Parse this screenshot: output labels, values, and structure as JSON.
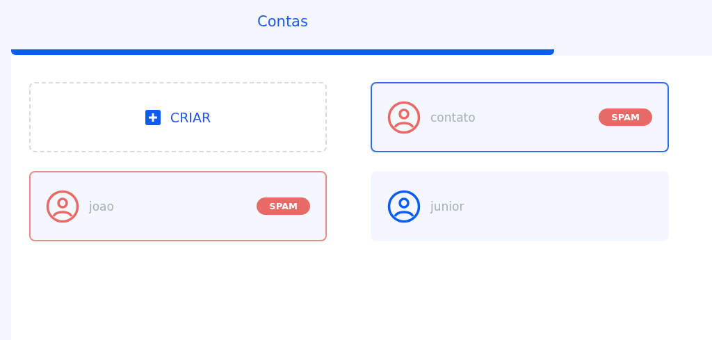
{
  "tabs": [
    {
      "label": "Contas",
      "selected": true
    }
  ],
  "create_button": {
    "label": "CRIAR"
  },
  "accounts": [
    {
      "name": "contato",
      "spam": true,
      "selected": true,
      "badge": "SPAM"
    },
    {
      "name": "joao",
      "spam": true,
      "selected": false,
      "badge": "SPAM"
    },
    {
      "name": "junior",
      "spam": false,
      "selected": false
    }
  ]
}
